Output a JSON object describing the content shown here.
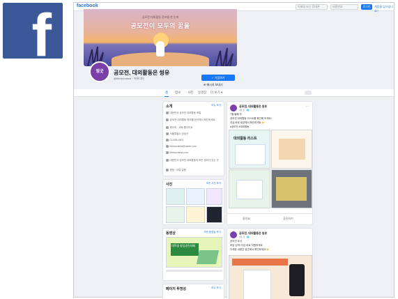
{
  "logo": {
    "letter": "f",
    "bg_color": "#3b5998"
  },
  "topbar": {
    "brand": "facebook",
    "email_placeholder": "이메일 또는 휴대폰",
    "password_placeholder": "비밀번호",
    "login_label": "로그인",
    "forgot_label": "계정을 잊으셨나요?"
  },
  "cover": {
    "subtitle": "공모전·대외활동 정보를 한 눈에",
    "title": "공모전이 모두의 꿈을"
  },
  "profile": {
    "avatar_text": "씽굿",
    "page_name": "공모전, 대외활동은 씽유",
    "handle": "@thinkcontest · 커뮤니티",
    "signup_label": "✓ 가입하기",
    "message_label": "✉ 메시지 보내기"
  },
  "tabs": [
    {
      "label": "홈"
    },
    {
      "label": "정보"
    },
    {
      "label": "사진"
    },
    {
      "label": "동영상"
    },
    {
      "label": "더 보기 ▾"
    }
  ],
  "intro": {
    "title": "소개",
    "link": "모두 보기",
    "rows": [
      "대한민국 공모전 대외활동 포털",
      "공모전·대외활동 정보를 한곳에서 확인하세요",
      "페이지 · 교육 웹사이트",
      "서울특별시 강남구",
      "02-538-4907",
      "thinkcontest@naver.com",
      "thinkcontest.com",
      "대한민국 공모전 대외활동의 모든 정보가 있는 곳",
      "평점 · 리뷰 없음"
    ]
  },
  "photos": {
    "title": "사진",
    "link": "모든 사진 보기"
  },
  "videos": {
    "title": "동영상",
    "link": "모든 동영상 보기",
    "caption": "대학생 창업경진대회"
  },
  "transparency": {
    "title": "페이지 투명성",
    "link": "모두 보기"
  },
  "post1": {
    "name": "공모전, 대외활동은 씽유",
    "time": "3일 전 · 🌐",
    "lines": [
      "7월 둘째 주",
      "공모전 대외활동 리스트를 확인해 보세요!",
      "지금 바로 씽굿에서 확인하세요 👉",
      "#공모전 #대외활동"
    ],
    "image_title": "대외활동 리스트",
    "like": "좋아요",
    "share": "공유하기"
  },
  "post2": {
    "name": "공모전, 대외활동은 씽유",
    "time": "5일 전 · 🌐",
    "lines": [
      "공모전 소식",
      "마감 임박! 지금 바로 지원하세요",
      "자세한 내용은 씽굿에서 확인하세요 👉"
    ]
  }
}
